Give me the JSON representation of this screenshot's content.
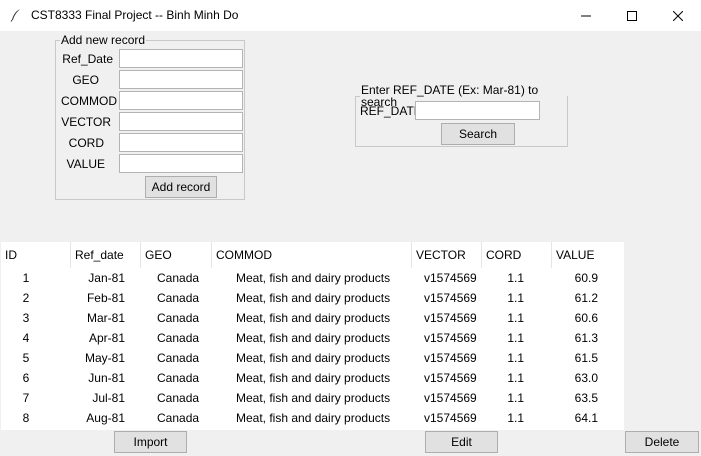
{
  "window": {
    "title": "CST8333 Final Project -- Binh Minh Do"
  },
  "add_record": {
    "legend": "Add new record",
    "fields": [
      {
        "label": "Ref_Date",
        "value": ""
      },
      {
        "label": "GEO",
        "value": ""
      },
      {
        "label": "COMMOD",
        "value": ""
      },
      {
        "label": "VECTOR",
        "value": ""
      },
      {
        "label": "CORD",
        "value": ""
      },
      {
        "label": "VALUE",
        "value": ""
      }
    ],
    "button_label": "Add record"
  },
  "search": {
    "legend": "Enter REF_DATE (Ex: Mar-81) to search",
    "label": "REF_DATE",
    "value": "",
    "button_label": "Search"
  },
  "table": {
    "columns": [
      "ID",
      "Ref_date",
      "GEO",
      "COMMOD",
      "VECTOR",
      "CORD",
      "VALUE"
    ],
    "rows": [
      [
        "1",
        "Jan-81",
        "Canada",
        "Meat, fish and dairy products",
        "v1574569",
        "1.1",
        "60.9"
      ],
      [
        "2",
        "Feb-81",
        "Canada",
        "Meat, fish and dairy products",
        "v1574569",
        "1.1",
        "61.2"
      ],
      [
        "3",
        "Mar-81",
        "Canada",
        "Meat, fish and dairy products",
        "v1574569",
        "1.1",
        "60.6"
      ],
      [
        "4",
        "Apr-81",
        "Canada",
        "Meat, fish and dairy products",
        "v1574569",
        "1.1",
        "61.3"
      ],
      [
        "5",
        "May-81",
        "Canada",
        "Meat, fish and dairy products",
        "v1574569",
        "1.1",
        "61.5"
      ],
      [
        "6",
        "Jun-81",
        "Canada",
        "Meat, fish and dairy products",
        "v1574569",
        "1.1",
        "63.0"
      ],
      [
        "7",
        "Jul-81",
        "Canada",
        "Meat, fish and dairy products",
        "v1574569",
        "1.1",
        "63.5"
      ],
      [
        "8",
        "Aug-81",
        "Canada",
        "Meat, fish and dairy products",
        "v1574569",
        "1.1",
        "64.1"
      ]
    ]
  },
  "actions": {
    "import_label": "Import",
    "edit_label": "Edit",
    "delete_label": "Delete"
  }
}
